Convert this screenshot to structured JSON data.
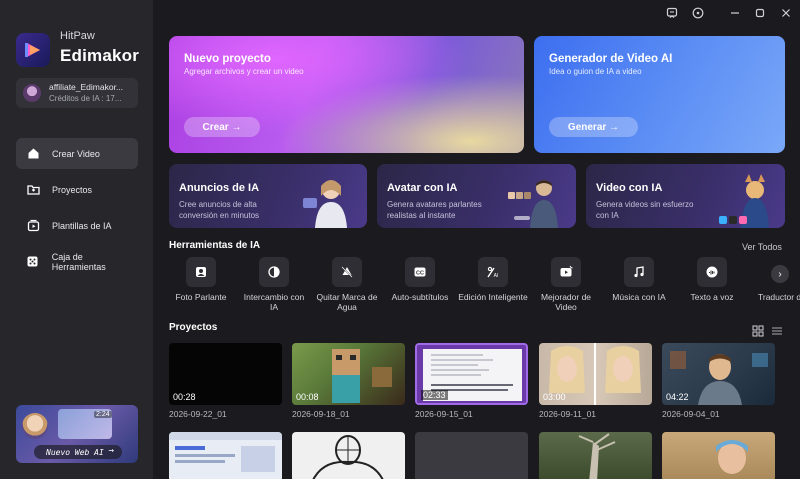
{
  "app": {
    "brand_small": "HitPaw",
    "brand_large": "Edimakor"
  },
  "account": {
    "name": "affiliate_Edimakor...",
    "credits": "Créditos de IA : 17..."
  },
  "sidebar": {
    "items": [
      {
        "label": "Crear Video",
        "icon": "home-icon",
        "active": true
      },
      {
        "label": "Proyectos",
        "icon": "folder-icon",
        "active": false
      },
      {
        "label": "Plantillas de IA",
        "icon": "template-icon",
        "active": false
      },
      {
        "label": "Caja de Herramientas",
        "icon": "toolbox-icon",
        "active": false
      }
    ],
    "promo_label": "Nuevo Web AI",
    "promo_time": "2:24"
  },
  "hero": {
    "new_project": {
      "title": "Nuevo proyecto",
      "subtitle": "Agregar archivos y crear un video",
      "button": "Crear →"
    },
    "ai_video": {
      "title": "Generador de Video AI",
      "subtitle": "Idea o guion de IA a video",
      "button": "Generar →"
    }
  },
  "features": [
    {
      "title": "Anuncios de IA",
      "desc": "Cree anuncios de alta conversión en minutos"
    },
    {
      "title": "Avatar con IA",
      "desc": "Genera avatares parlantes realistas al instante"
    },
    {
      "title": "Video con IA",
      "desc": "Genera videos sin esfuerzo con IA"
    }
  ],
  "tools_section": {
    "title": "Herramientas de IA",
    "see_all": "Ver Todos",
    "items": [
      {
        "label": "Foto Parlante",
        "icon": "portrait-icon"
      },
      {
        "label": "Intercambio con IA",
        "icon": "face-swap-icon"
      },
      {
        "label": "Quitar Marca de Agua",
        "icon": "watermark-remove-icon"
      },
      {
        "label": "Auto-subtítulos",
        "icon": "cc-icon"
      },
      {
        "label": "Edición Inteligente",
        "icon": "ai-edit-icon"
      },
      {
        "label": "Mejorador de Video",
        "icon": "video-enhance-icon"
      },
      {
        "label": "Música con IA",
        "icon": "music-icon"
      },
      {
        "label": "Texto a voz",
        "icon": "tts-icon"
      },
      {
        "label": "Traductor de video",
        "icon": "translate-icon"
      }
    ]
  },
  "projects_section": {
    "title": "Proyectos",
    "items": [
      {
        "duration": "00:28",
        "date": "2026-09-22_01"
      },
      {
        "duration": "00:08",
        "date": "2026-09-18_01"
      },
      {
        "duration": "02:33",
        "date": "2026-09-15_01"
      },
      {
        "duration": "03:00",
        "date": "2026-09-11_01"
      },
      {
        "duration": "04:22",
        "date": "2026-09-04_01"
      }
    ]
  },
  "colors": {
    "background": "#1b1b1f",
    "sidebar": "#26262b",
    "accent_purple": "#b85cf0",
    "accent_blue": "#4a7ef2"
  }
}
